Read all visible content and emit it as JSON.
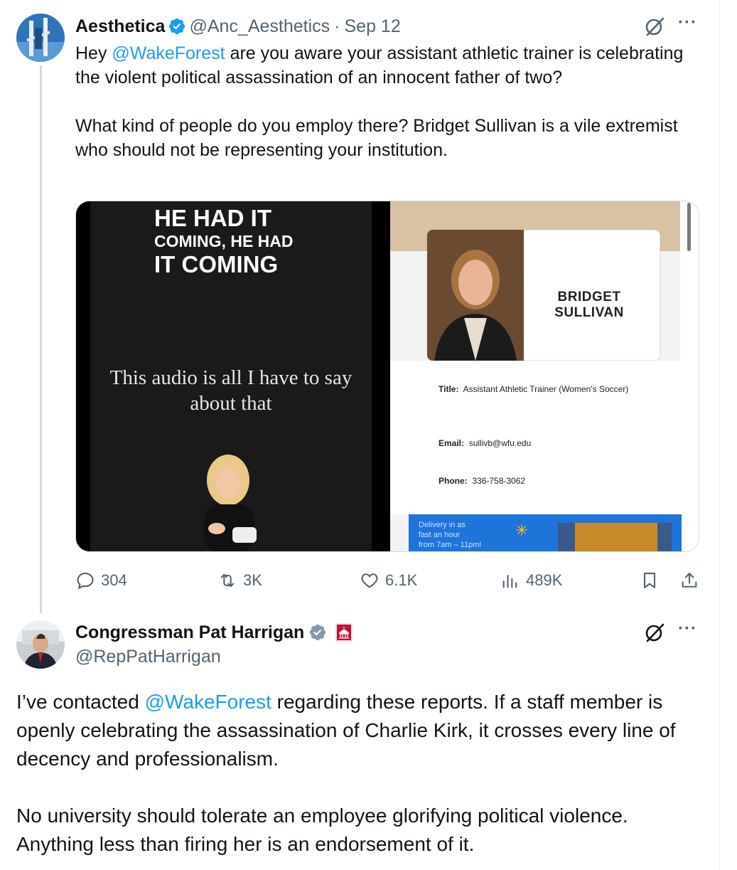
{
  "colors": {
    "link": "#1d9bf0",
    "secondary": "#536471",
    "verified_blue": "#1d9bf0",
    "verified_gray": "#829aab"
  },
  "tweet1": {
    "display_name": "Aesthetica",
    "handle": "@Anc_Aesthetics",
    "separator": "·",
    "date": "Sep 12",
    "text_parts": {
      "p1_pre": "Hey ",
      "p1_mention": "@WakeForest",
      "p1_post": " are you aware your assistant athletic trainer is celebrating the violent political assassination of an innocent father of two?",
      "p2": "What kind of people do you employ there? Bridget Sullivan is a vile extremist who should not be representing your institution."
    },
    "media": {
      "left": {
        "line1": "HE HAD IT",
        "line2": "COMING, HE HAD",
        "line3": "IT COMING",
        "subtitle": "This audio is all I have to say about that"
      },
      "right": {
        "name": "BRIDGET SULLIVAN",
        "title_label": "Title:",
        "title_value": "Assistant Athletic Trainer (Women's Soccer)",
        "email_label": "Email:",
        "email_value": "sullivb@wfu.edu",
        "phone_label": "Phone:",
        "phone_value": "336-758-3062",
        "ad_line1": "Delivery in as",
        "ad_line2": "fast an hour",
        "ad_line3": "from 7am – 11pm!"
      }
    },
    "stats": {
      "replies": "304",
      "reposts": "3K",
      "likes": "6.1K",
      "views": "489K"
    },
    "icons": [
      "verified-badge",
      "grok-icon",
      "more-icon",
      "reply-icon",
      "repost-icon",
      "like-icon",
      "views-icon",
      "bookmark-icon",
      "share-icon"
    ]
  },
  "tweet2": {
    "display_name": "Congressman Pat Harrigan",
    "handle": "@RepPatHarrigan",
    "text_parts": {
      "p1_pre": "I’ve contacted ",
      "p1_mention": "@WakeForest",
      "p1_post": " regarding these reports. If a staff member is openly celebrating the assassination of Charlie Kirk, it crosses every line of decency and professionalism.",
      "p2": "No university should tolerate an employee glorifying political violence. Anything less than firing her is an endorsement of it."
    },
    "icons": [
      "gray-verified-badge",
      "capitol-icon",
      "grok-icon",
      "more-icon"
    ]
  }
}
